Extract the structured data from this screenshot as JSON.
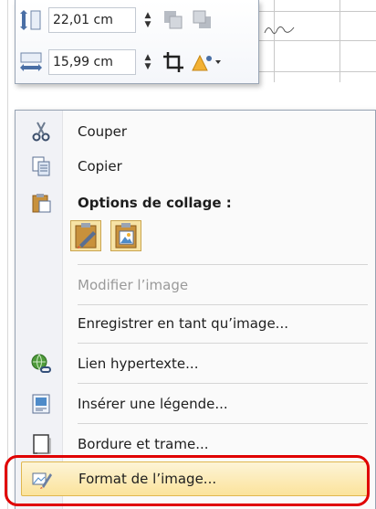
{
  "mini_toolbar": {
    "height_value": "22,01 cm",
    "width_value": "15,99 cm"
  },
  "menu": {
    "items": [
      {
        "label": "Couper",
        "icon": "scissors-icon",
        "enabled": true
      },
      {
        "label": "Copier",
        "icon": "copy-icon",
        "enabled": true
      },
      {
        "label": "Options de collage :",
        "icon": "clipboard-icon",
        "enabled": true,
        "bold": true
      },
      {
        "label": "Modifier l’image",
        "enabled": false
      },
      {
        "label": "Enregistrer en tant qu’image...",
        "enabled": true
      },
      {
        "label": "Lien hypertexte...",
        "icon": "hyperlink-globe-icon",
        "enabled": true
      },
      {
        "label": "Insérer une légende...",
        "icon": "caption-icon",
        "enabled": true
      },
      {
        "label": "Bordure et trame...",
        "icon": "border-shading-icon",
        "enabled": true
      },
      {
        "label": "Format de l’image...",
        "icon": "format-picture-icon",
        "enabled": true,
        "highlighted": true
      }
    ]
  },
  "colors": {
    "highlight_start": "#fdf4d7",
    "highlight_end": "#fbe39b",
    "callout_red": "#e00000"
  }
}
